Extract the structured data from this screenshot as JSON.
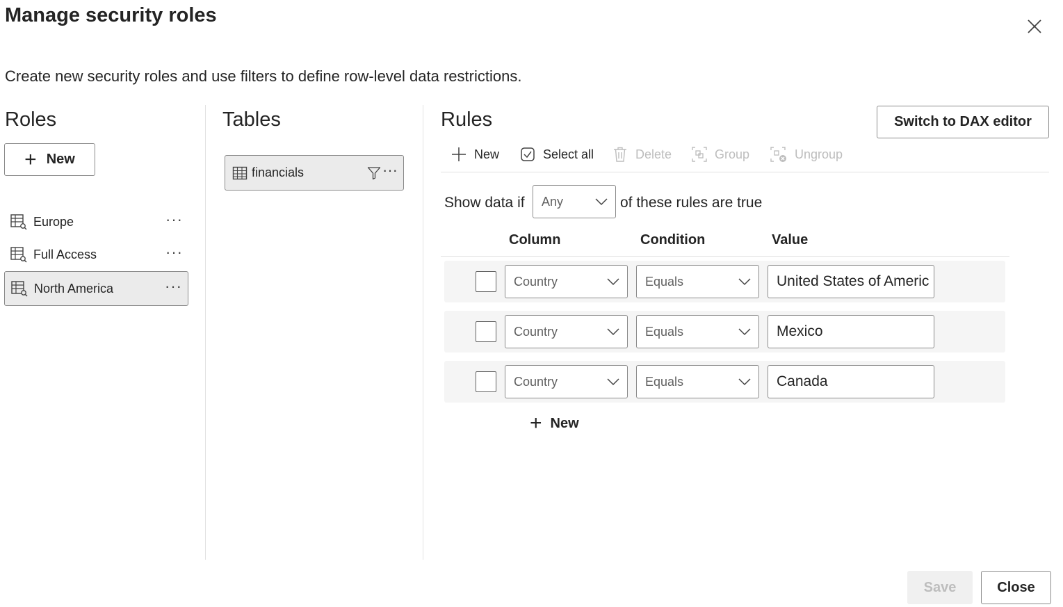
{
  "dialog": {
    "title": "Manage security roles",
    "description": "Create new security roles and use filters to define row-level data restrictions."
  },
  "roles": {
    "heading": "Roles",
    "new_label": "New",
    "items": [
      {
        "label": "Europe",
        "more": "···"
      },
      {
        "label": "Full Access",
        "more": "···"
      },
      {
        "label": "North America",
        "more": "···",
        "selected": true
      }
    ]
  },
  "tables": {
    "heading": "Tables",
    "items": [
      {
        "label": "financials",
        "more": "···"
      }
    ]
  },
  "rules": {
    "heading": "Rules",
    "switch_label": "Switch to DAX editor",
    "toolbar": {
      "new": "New",
      "select_all": "Select all",
      "delete": "Delete",
      "group": "Group",
      "ungroup": "Ungroup"
    },
    "show_prefix": "Show data if",
    "match_mode": "Any",
    "show_suffix": "of these rules are true",
    "columns": {
      "column": "Column",
      "condition": "Condition",
      "value": "Value"
    },
    "rows": [
      {
        "column": "Country",
        "condition": "Equals",
        "value": "United States of Americ"
      },
      {
        "column": "Country",
        "condition": "Equals",
        "value": "Mexico"
      },
      {
        "column": "Country",
        "condition": "Equals",
        "value": "Canada"
      }
    ],
    "add_rule_label": "New"
  },
  "footer": {
    "save_label": "Save",
    "close_label": "Close"
  },
  "colors": {
    "border": "#8a8a8a",
    "selected_bg": "#ebebeb",
    "row_bg": "#f5f5f5",
    "disabled_text": "#bdbdbd",
    "text": "#242424"
  }
}
